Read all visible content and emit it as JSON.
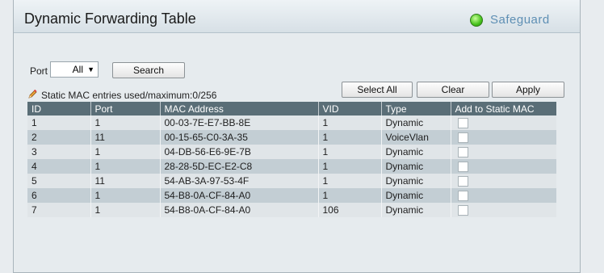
{
  "header": {
    "title": "Dynamic Forwarding Table",
    "safeguard_label": "Safeguard",
    "safeguard_color": "#46c21c"
  },
  "filter": {
    "port_label": "Port",
    "port_value": "All",
    "search_label": "Search"
  },
  "info": {
    "static_mac_text": "Static MAC entries used/maximum:0/256",
    "icon": "pencil-icon"
  },
  "actions": {
    "select_all_label": "Select All",
    "clear_label": "Clear",
    "apply_label": "Apply"
  },
  "table": {
    "columns": [
      "ID",
      "Port",
      "MAC Address",
      "VID",
      "Type",
      "Add to Static MAC"
    ],
    "rows": [
      {
        "id": "1",
        "port": "1",
        "mac": "00-03-7E-E7-BB-8E",
        "vid": "1",
        "type": "Dynamic",
        "checked": false
      },
      {
        "id": "2",
        "port": "11",
        "mac": "00-15-65-C0-3A-35",
        "vid": "1",
        "type": "VoiceVlan",
        "checked": false
      },
      {
        "id": "3",
        "port": "1",
        "mac": "04-DB-56-E6-9E-7B",
        "vid": "1",
        "type": "Dynamic",
        "checked": false
      },
      {
        "id": "4",
        "port": "1",
        "mac": "28-28-5D-EC-E2-C8",
        "vid": "1",
        "type": "Dynamic",
        "checked": false
      },
      {
        "id": "5",
        "port": "11",
        "mac": "54-AB-3A-97-53-4F",
        "vid": "1",
        "type": "Dynamic",
        "checked": false
      },
      {
        "id": "6",
        "port": "1",
        "mac": "54-B8-0A-CF-84-A0",
        "vid": "1",
        "type": "Dynamic",
        "checked": false
      },
      {
        "id": "7",
        "port": "1",
        "mac": "54-B8-0A-CF-84-A0",
        "vid": "106",
        "type": "Dynamic",
        "checked": false
      }
    ]
  }
}
